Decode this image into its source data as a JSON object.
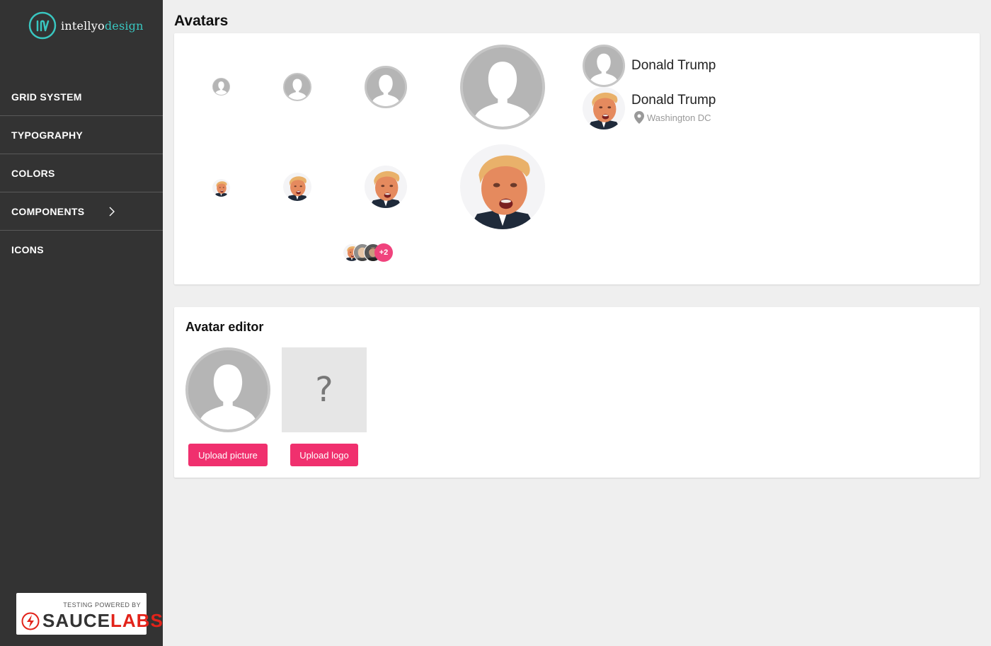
{
  "brand": {
    "name_part1": "intellyo",
    "name_part2": "design",
    "accent": "#39c6c0"
  },
  "nav": {
    "items": [
      {
        "label": "GRID SYSTEM"
      },
      {
        "label": "TYPOGRAPHY"
      },
      {
        "label": "COLORS"
      },
      {
        "label": "COMPONENTS",
        "icon": "chevron-right-icon"
      },
      {
        "label": "ICONS"
      }
    ]
  },
  "sauce": {
    "powered": "TESTING POWERED BY",
    "word1": "SAUCE",
    "word2": "LABS"
  },
  "page": {
    "title": "Avatars"
  },
  "avatars": {
    "user": {
      "name": "Donald Trump",
      "location": "Washington DC"
    },
    "group_more": "+2"
  },
  "editor": {
    "title": "Avatar editor",
    "logo_placeholder": "?",
    "upload_picture": "Upload picture",
    "upload_logo": "Upload logo"
  },
  "colors": {
    "primary": "#f0306e",
    "sidebar": "#333333",
    "placeholder": "#b5b5b5"
  }
}
